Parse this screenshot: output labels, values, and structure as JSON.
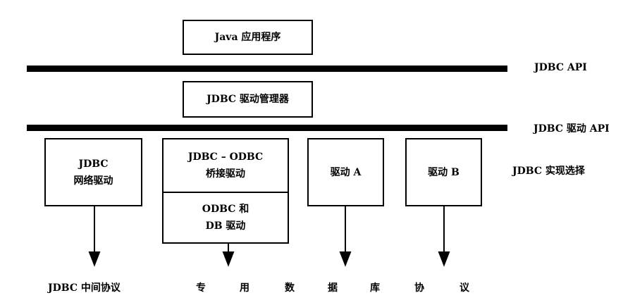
{
  "diagram": {
    "app_box": "Java 应用程序",
    "api_label": "JDBC API",
    "manager_box": "JDBC 驱动管理器",
    "driver_api_label": "JDBC 驱动 API",
    "impl_label": "JDBC 实现选择",
    "net_driver": [
      "JDBC",
      "网络驱动"
    ],
    "bridge": [
      "JDBC – ODBC",
      "桥接驱动"
    ],
    "odbc_db": [
      "ODBC 和",
      "DB 驱动"
    ],
    "driver_a": "驱动 A",
    "driver_b": "驱动 B",
    "middle_protocol": "JDBC 中间协议",
    "proprietary_protocol": [
      "专",
      "用",
      "数",
      "据",
      "库",
      "协",
      "议"
    ]
  }
}
